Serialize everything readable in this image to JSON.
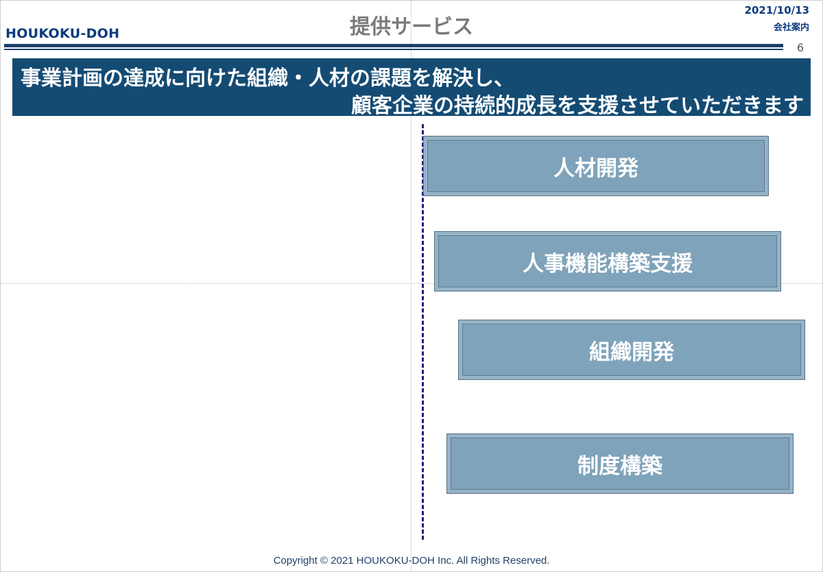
{
  "header": {
    "logo": "HOUKOKU-DOH",
    "title": "提供サービス",
    "date": "2021/10/13",
    "doc_type": "会社案内",
    "page_number": "6"
  },
  "banner": {
    "line1": "事業計画の達成に向けた組織・人材の課題を解決し、",
    "line2": "顧客企業の持続的成長を支援させていただきます"
  },
  "services": [
    {
      "label": "人材開発"
    },
    {
      "label": "人事機能構築支援"
    },
    {
      "label": "組織開発"
    },
    {
      "label": "制度構築"
    }
  ],
  "footer": {
    "copyright": "Copyright © 2021 HOUKOKU-DOH Inc. All Rights Reserved."
  },
  "colors": {
    "brand": "#0b3a7d",
    "banner": "#144b73",
    "box_fill": "#7fa3ba",
    "dashed_line": "#1a1a80"
  }
}
